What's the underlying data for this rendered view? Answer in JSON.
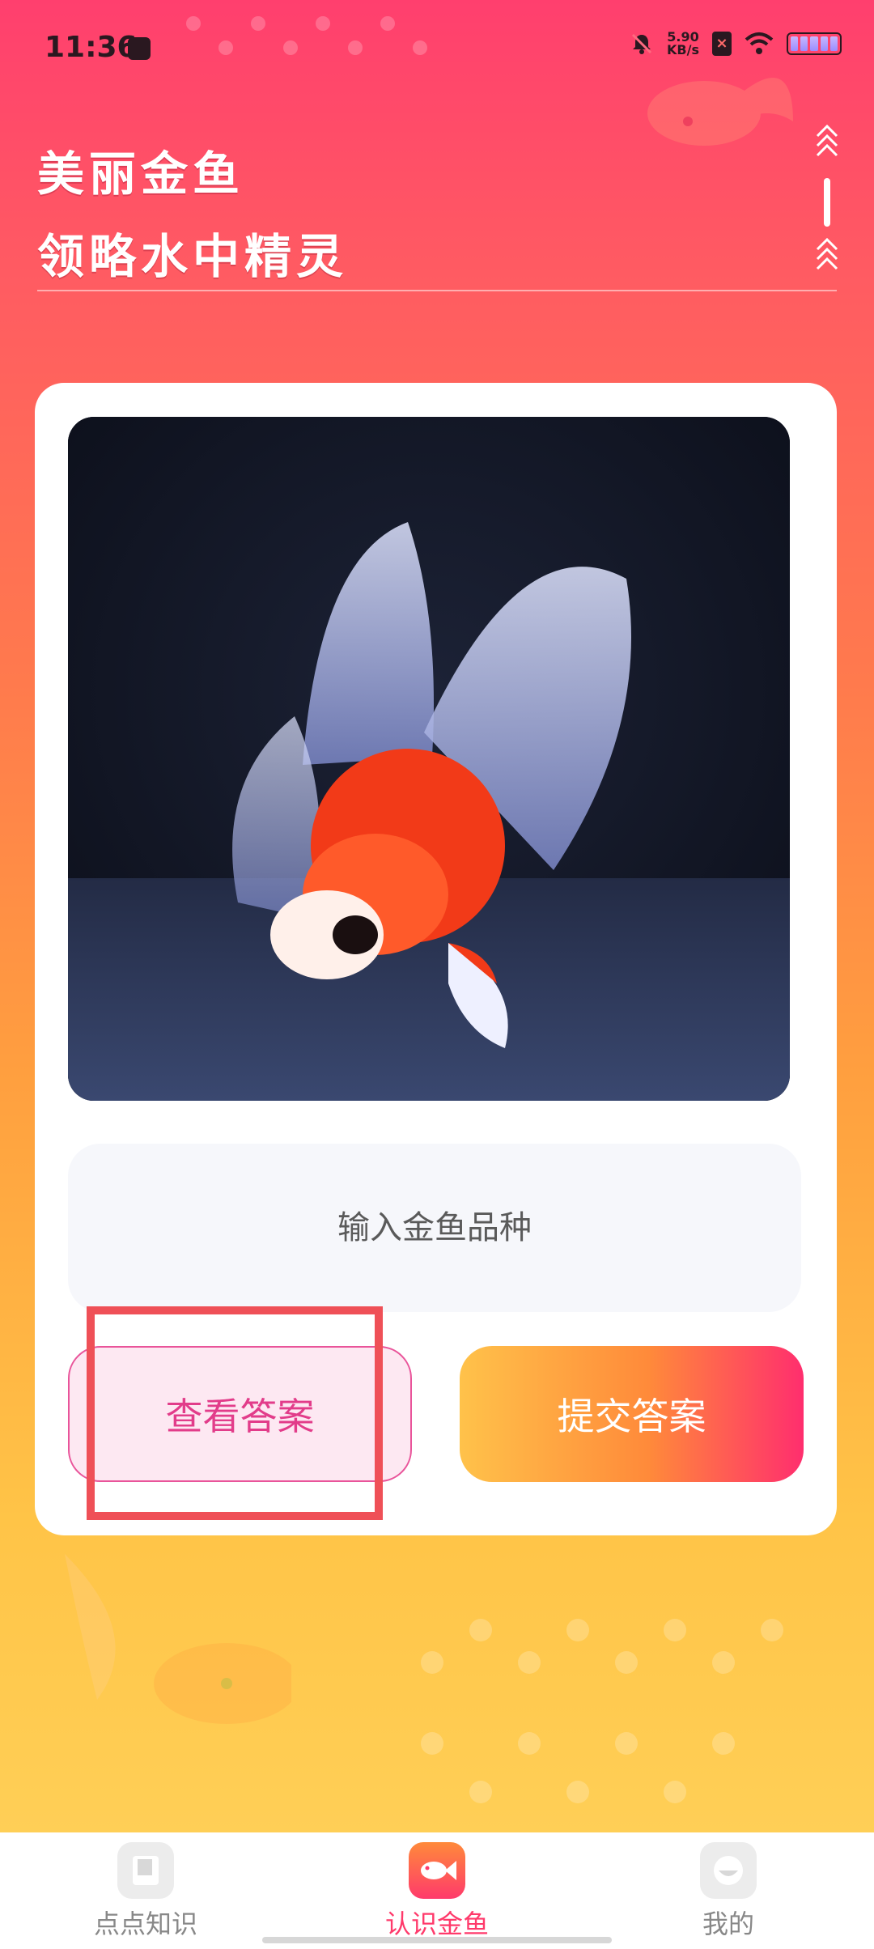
{
  "status_bar": {
    "time": "11:36",
    "net_speed_value": "5.90",
    "net_speed_unit": "KB/s",
    "icons": [
      "app-notification-icon",
      "bell-muted-icon",
      "sim-icon",
      "wifi-icon",
      "battery-icon"
    ]
  },
  "header": {
    "line1": "美丽金鱼",
    "line2": "领略水中精灵"
  },
  "quiz": {
    "image_description": "goldfish-photo",
    "input_placeholder": "输入金鱼品种",
    "input_value": "",
    "view_answer_label": "查看答案",
    "submit_answer_label": "提交答案"
  },
  "bottom_nav": {
    "items": [
      {
        "label": "点点知识",
        "icon": "book-icon",
        "active": false
      },
      {
        "label": "认识金鱼",
        "icon": "fish-icon",
        "active": true
      },
      {
        "label": "我的",
        "icon": "profile-icon",
        "active": false
      }
    ]
  },
  "colors": {
    "accent": "#ff3a6b",
    "gradient_top": "#ff3f6e",
    "gradient_bottom": "#ffd35c",
    "highlight": "#ef5057"
  }
}
